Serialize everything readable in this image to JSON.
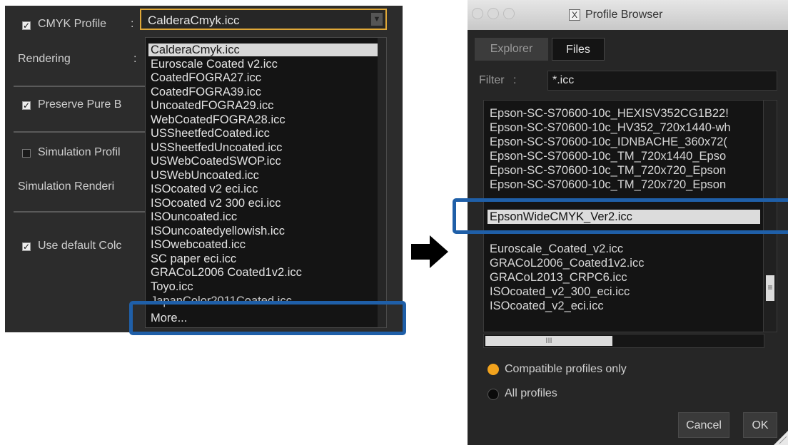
{
  "left_panel": {
    "cmyk_profile_label": "CMYK Profile",
    "colon": ":",
    "rendering_label": "Rendering",
    "preserve_label": "Preserve Pure B",
    "simulation_profile_label": "Simulation Profil",
    "simulation_rendering_label": "Simulation Renderi",
    "use_default_label": "Use default Colc",
    "combo_value": "CalderaCmyk.icc",
    "dropdown_items": [
      "CalderaCmyk.icc",
      "Euroscale Coated v2.icc",
      "CoatedFOGRA27.icc",
      "CoatedFOGRA39.icc",
      "UncoatedFOGRA29.icc",
      "WebCoatedFOGRA28.icc",
      "USSheetfedCoated.icc",
      "USSheetfedUncoated.icc",
      "USWebCoatedSWOP.icc",
      "USWebUncoated.icc",
      "ISOcoated v2 eci.icc",
      "ISOcoated v2 300 eci.icc",
      "ISOuncoated.icc",
      "ISOuncoatedyellowish.icc",
      "ISOwebcoated.icc",
      "SC paper eci.icc",
      "GRACoL2006 Coated1v2.icc",
      "Toyo.icc",
      "JapanColor2011Coated.icc",
      "More..."
    ]
  },
  "window": {
    "title": "Profile Browser",
    "tabs": [
      "Explorer",
      "Files"
    ],
    "filter_label": "Filter",
    "filter_value": "*.icc",
    "files": [
      "Epson-SC-S70600-10c_HEXISV352CG1B22!",
      "Epson-SC-S70600-10c_HV352_720x1440-wh",
      "Epson-SC-S70600-10c_IDNBACHE_360x72(",
      "Epson-SC-S70600-10c_TM_720x1440_Epso",
      "Epson-SC-S70600-10c_TM_720x720_Epson",
      "Epson-SC-S70600-10c_TM_720x720_Epson",
      "EpsonWideCMYK_Ver2.icc",
      "Euroscale_Coated_v2.icc",
      "GRACoL2006_Coated1v2.icc",
      "GRACoL2013_CRPC6.icc",
      "ISOcoated_v2_300_eci.icc",
      "ISOcoated_v2_eci.icc"
    ],
    "radio_compatible": "Compatible profiles only",
    "radio_all": "All profiles",
    "cancel_label": "Cancel",
    "ok_label": "OK"
  },
  "colors": {
    "highlight": "#1f5fa8",
    "accent_orange": "#f2a31d",
    "panel_bg": "#2c2c2c"
  }
}
